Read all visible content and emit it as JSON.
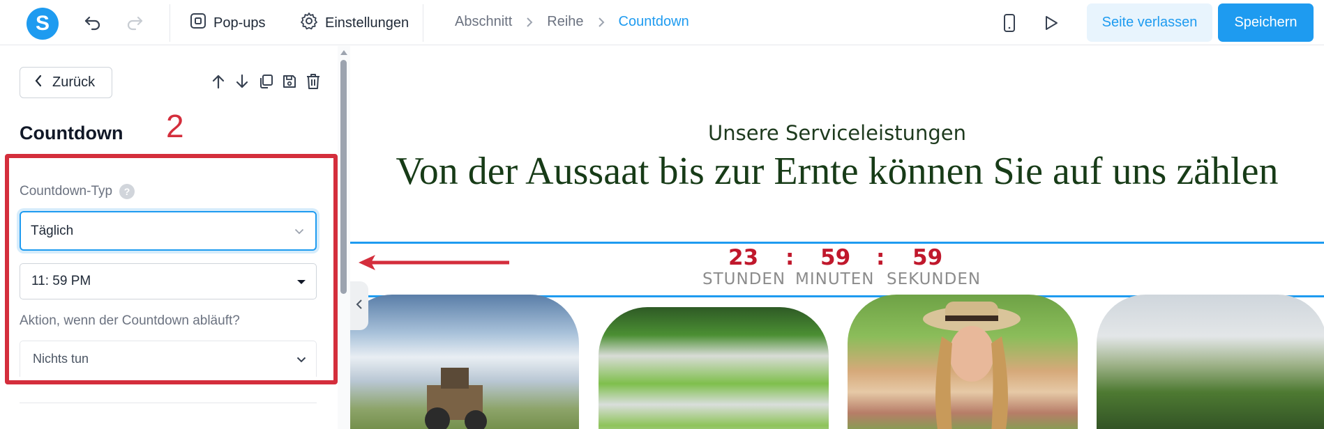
{
  "topbar": {
    "logo_letter": "S",
    "popups_label": "Pop-ups",
    "settings_label": "Einstellungen",
    "breadcrumb": [
      "Abschnitt",
      "Reihe",
      "Countdown"
    ],
    "leave_label": "Seite verlassen",
    "save_label": "Speichern",
    "icons": [
      "undo-icon",
      "redo-icon",
      "popups-icon",
      "gear-icon",
      "mobile-preview-icon",
      "play-icon"
    ]
  },
  "panel": {
    "back_label": "Zurück",
    "title": "Countdown",
    "annotation_number": "2",
    "countdown_type_label": "Countdown-Typ",
    "help_glyph": "?",
    "countdown_type_value": "Täglich",
    "time_value": "11: 59 PM",
    "action_label": "Aktion, wenn der Countdown abläuft?",
    "action_value": "Nichts tun",
    "tool_icons": [
      "move-up-icon",
      "move-down-icon",
      "duplicate-icon",
      "save-icon",
      "trash-icon"
    ]
  },
  "canvas": {
    "subtitle": "Unsere Serviceleistungen",
    "headline": "Von der Aussaat bis zur Ernte können Sie auf uns zählen",
    "countdown": {
      "hours": "23",
      "minutes": "59",
      "seconds": "59",
      "separator": ":",
      "hours_label": "STUNDEN",
      "minutes_label": "MINUTEN",
      "seconds_label": "SEKUNDEN"
    },
    "images": [
      "tractor-field-image",
      "hydroponic-lettuce-image",
      "woman-in-field-image",
      "greenhouse-plants-image"
    ]
  },
  "colors": {
    "accent": "#1e9bf0",
    "annotation_red": "#d42e3c",
    "countdown_number": "#c0182c",
    "headline_green": "#173b17"
  }
}
